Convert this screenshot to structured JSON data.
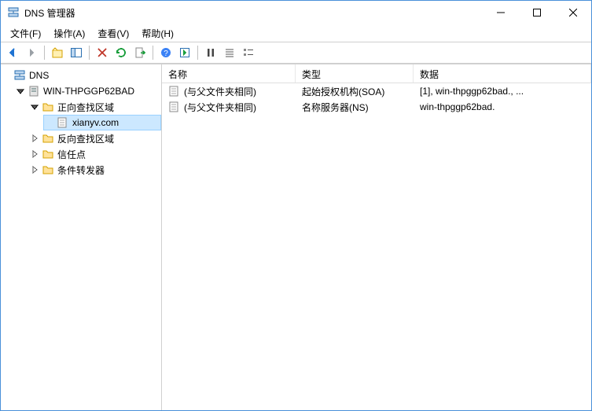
{
  "window": {
    "title": "DNS 管理器"
  },
  "menus": {
    "file": "文件(F)",
    "action": "操作(A)",
    "view": "查看(V)",
    "help": "帮助(H)"
  },
  "tree": {
    "root": "DNS",
    "server": "WIN-THPGGP62BAD",
    "forward_zones": "正向查找区域",
    "zone_xianyv": "xianyv.com",
    "reverse_zones": "反向查找区域",
    "trust_points": "信任点",
    "conditional_forwarders": "条件转发器"
  },
  "list": {
    "headers": {
      "name": "名称",
      "type": "类型",
      "data": "数据"
    },
    "rows": [
      {
        "name": "(与父文件夹相同)",
        "type": "起始授权机构(SOA)",
        "data": "[1], win-thpggp62bad., ..."
      },
      {
        "name": "(与父文件夹相同)",
        "type": "名称服务器(NS)",
        "data": "win-thpggp62bad."
      }
    ]
  }
}
